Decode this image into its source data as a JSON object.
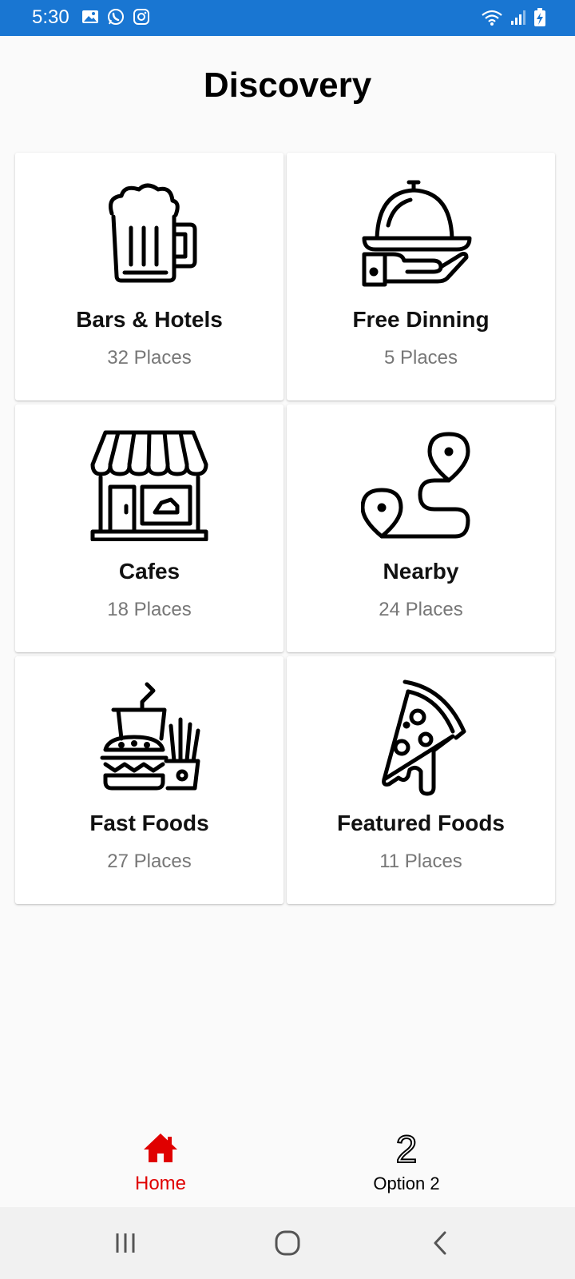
{
  "status_bar": {
    "time": "5:30",
    "left_icons": [
      "gallery-icon",
      "whatsapp-icon",
      "instagram-icon"
    ],
    "right_icons": [
      "wifi-icon",
      "signal-icon",
      "battery-charging-icon"
    ]
  },
  "page": {
    "title": "Discovery"
  },
  "categories": [
    {
      "name": "Bars & Hotels",
      "count": "32 Places",
      "icon": "beer-mug-icon"
    },
    {
      "name": "Free Dinning",
      "count": "5 Places",
      "icon": "cloche-serving-icon"
    },
    {
      "name": "Cafes",
      "count": "18 Places",
      "icon": "storefront-icon"
    },
    {
      "name": "Nearby",
      "count": "24 Places",
      "icon": "route-pins-icon"
    },
    {
      "name": "Fast Foods",
      "count": "27 Places",
      "icon": "fast-food-icon"
    },
    {
      "name": "Featured Foods",
      "count": "11 Places",
      "icon": "pizza-slice-icon"
    }
  ],
  "bottom_nav": {
    "home_label": "Home",
    "option2_label": "Option 2",
    "option2_glyph": "2",
    "active_color": "#e00000"
  },
  "colors": {
    "status_bar": "#1976d2",
    "background": "#fafafa",
    "card": "#ffffff",
    "subtext": "#777777"
  }
}
